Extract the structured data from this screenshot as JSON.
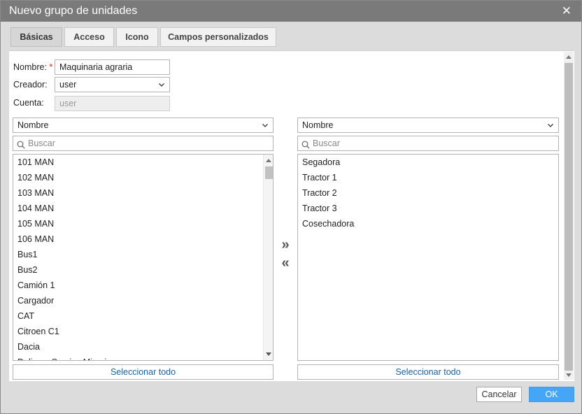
{
  "window": {
    "title": "Nuevo grupo de unidades"
  },
  "tabs": [
    {
      "label": "Básicas",
      "active": true
    },
    {
      "label": "Acceso",
      "active": false
    },
    {
      "label": "Icono",
      "active": false
    },
    {
      "label": "Campos personalizados",
      "active": false
    }
  ],
  "form": {
    "name_label": "Nombre:",
    "required_mark": "*",
    "name_value": "Maquinaria agraria",
    "creator_label": "Creador:",
    "creator_value": "user",
    "account_label": "Cuenta:",
    "account_value": "user"
  },
  "left_panel": {
    "sort_value": "Nombre",
    "search_placeholder": "Buscar",
    "items": [
      "101 MAN",
      "102 MAN",
      "103 MAN",
      "104 MAN",
      "105 MAN",
      "106 MAN",
      "Bus1",
      "Bus2",
      "Camión 1",
      "Cargador",
      "CAT",
      "Citroen C1",
      "Dacia",
      "Delivery Service Miami"
    ],
    "select_all": "Seleccionar todo"
  },
  "right_panel": {
    "sort_value": "Nombre",
    "search_placeholder": "Buscar",
    "items": [
      "Segadora",
      "Tractor 1",
      "Tractor 2",
      "Tractor 3",
      "Cosechadora"
    ],
    "select_all": "Seleccionar todo"
  },
  "transfer": {
    "add": "»",
    "remove": "«"
  },
  "footer": {
    "cancel_label": "Cancelar",
    "ok_label": "OK"
  },
  "colors": {
    "titlebar": "#7a7a7a",
    "ok_button": "#46a5f5",
    "link_text": "#1f5f99",
    "required": "#e02020"
  }
}
